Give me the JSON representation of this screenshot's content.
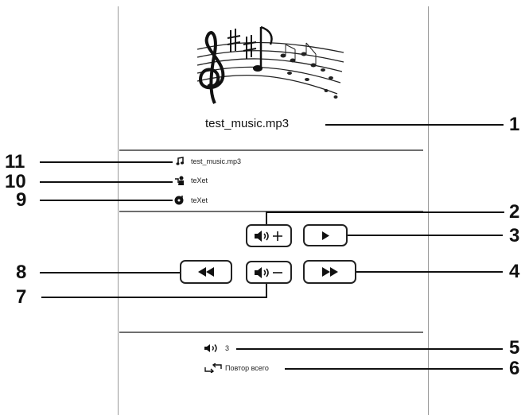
{
  "player": {
    "track_title": "test_music.mp3",
    "info": {
      "file": "test_music.mp3",
      "artist": "teXet",
      "album": "teXet"
    },
    "volume_value": "3",
    "repeat_mode": "Повтор всего"
  },
  "buttons": {
    "volume_up": "volume-up-icon",
    "play": "play-icon",
    "rewind": "rewind-icon",
    "volume_down": "volume-down-icon",
    "fast_forward": "fast-forward-icon"
  },
  "callouts": [
    "1",
    "2",
    "3",
    "4",
    "5",
    "6",
    "7",
    "8",
    "9",
    "10",
    "11"
  ]
}
